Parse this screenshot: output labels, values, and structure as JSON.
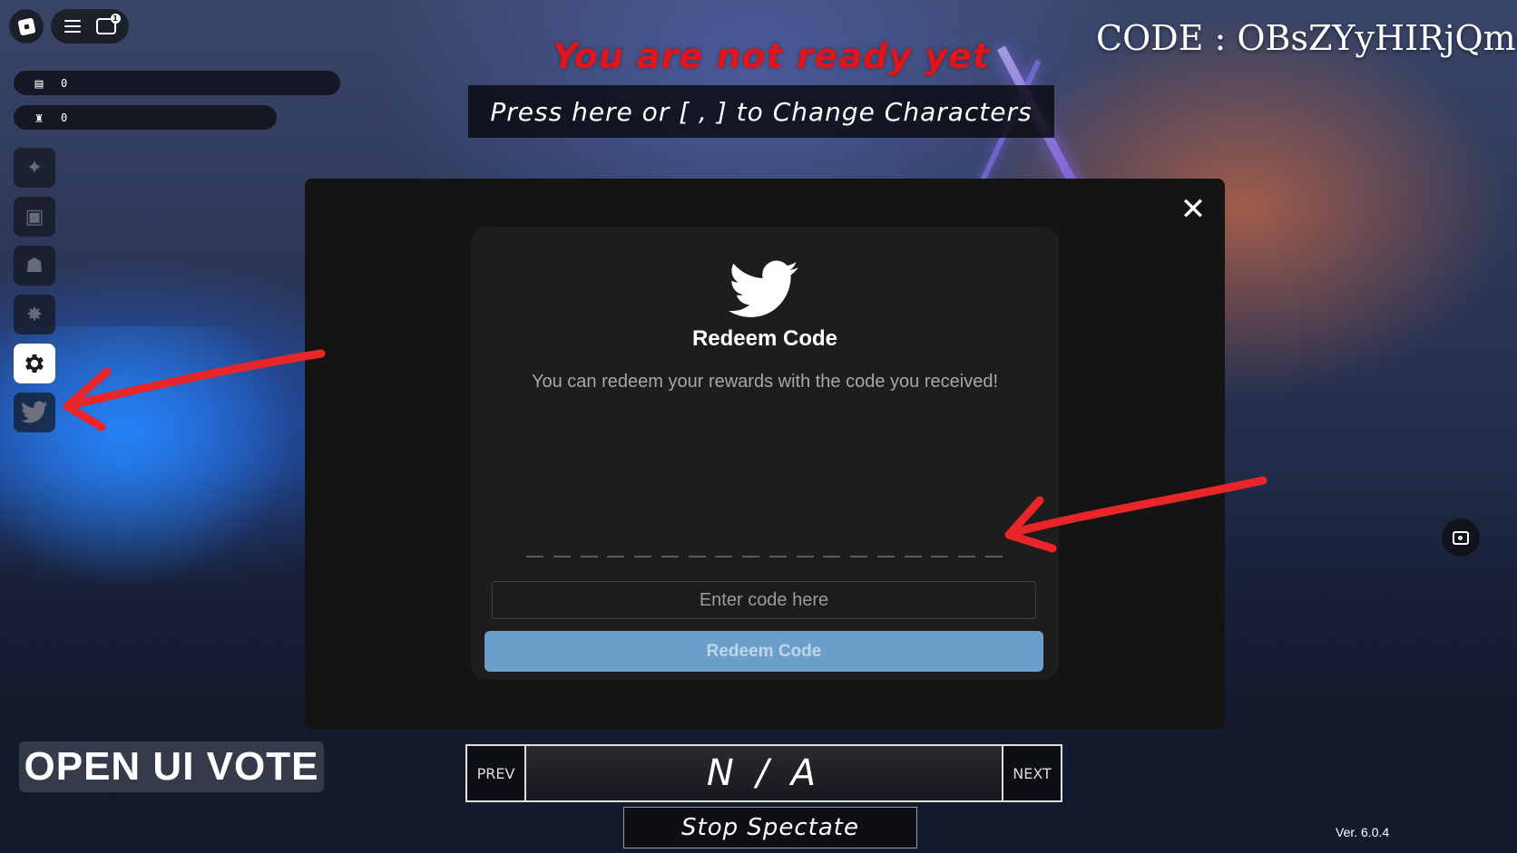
{
  "top": {
    "warning": "You are not ready yet",
    "change_characters": "Press  here or [ , ] to Change Characters",
    "code_banner": "CODE : OBsZYyHIRjQmO"
  },
  "topbar": {
    "chat_badge": "1"
  },
  "currency": [
    {
      "icon": "cash-stack-icon",
      "value": "0"
    },
    {
      "icon": "trophy-icon",
      "value": "0"
    }
  ],
  "sidebar": {
    "items": [
      {
        "icon": "sparkle-icon",
        "active": false
      },
      {
        "icon": "shop-bag-icon",
        "active": false
      },
      {
        "icon": "character-icon",
        "active": false
      },
      {
        "icon": "star-badge-icon",
        "active": false
      },
      {
        "icon": "gear-icon",
        "active": true
      },
      {
        "icon": "twitter-bird-icon",
        "active": false
      }
    ]
  },
  "modal": {
    "title": "Redeem Code",
    "description": "You can redeem your rewards with the code you received!",
    "input_placeholder": "Enter code here",
    "button_label": "Redeem Code",
    "close_glyph": "✕",
    "brand_color": "#6b9fc9"
  },
  "vote": {
    "label": "OPEN UI VOTE"
  },
  "spectate": {
    "prev_label": "PREV",
    "name": "N / A",
    "next_label": "NEXT",
    "stop_label": "Stop Spectate"
  },
  "version": "Ver. 6.0.4",
  "annotations": {
    "arrow_color": "#e8262a"
  }
}
